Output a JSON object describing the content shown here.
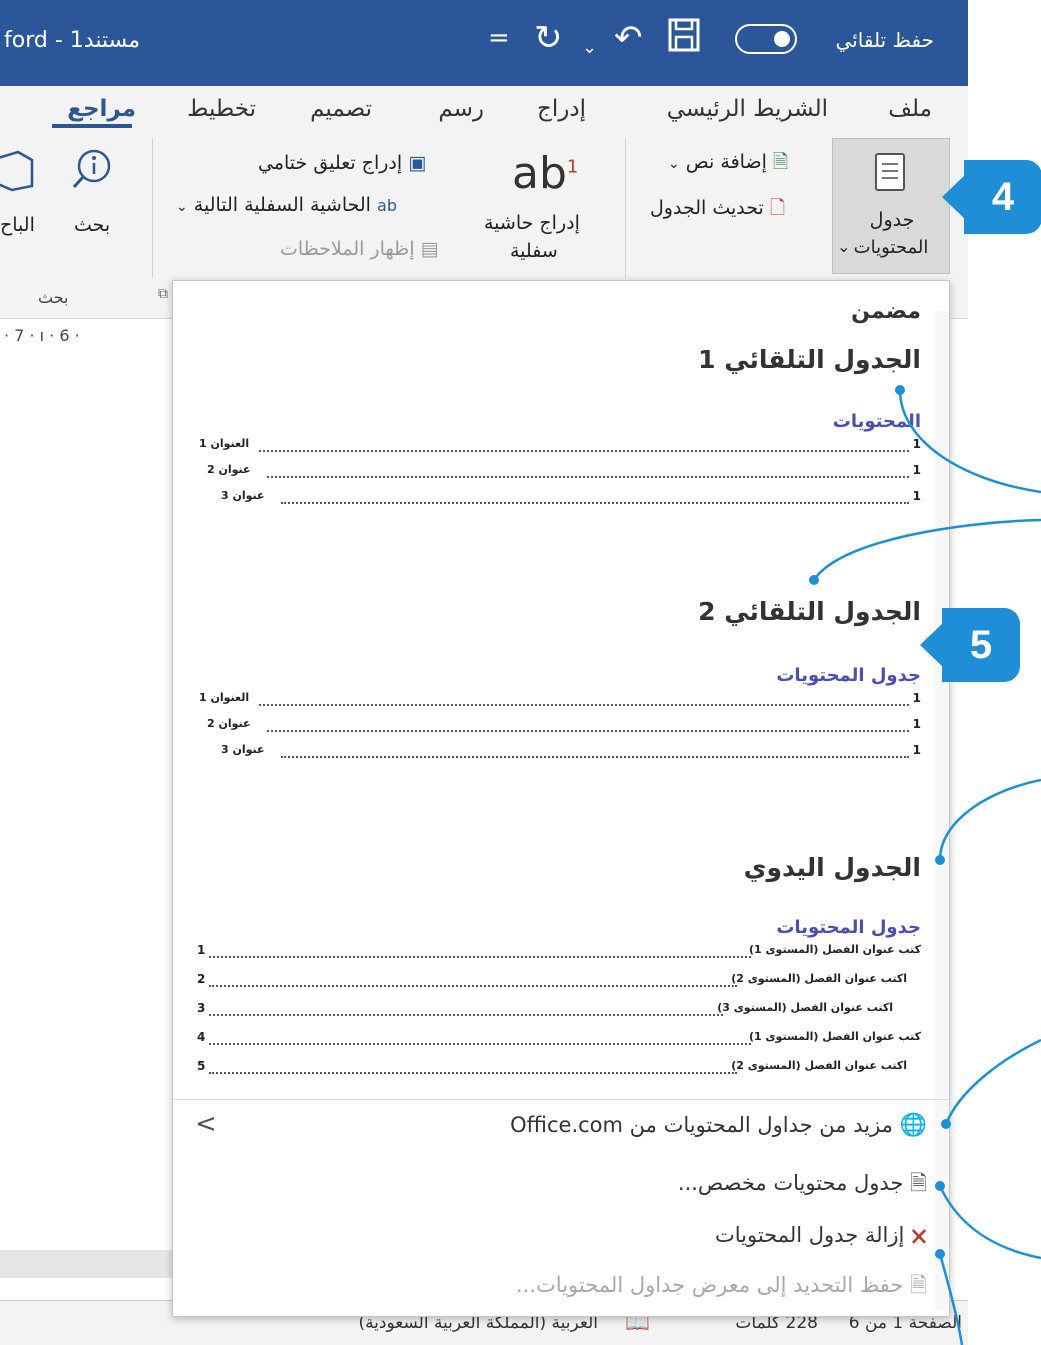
{
  "titlebar": {
    "doc_title": "ford - مستند1",
    "autosave_label": "حفظ تلقائي",
    "icons": [
      "save-icon",
      "redo-icon",
      "undo-icon",
      "customize-qat-icon"
    ]
  },
  "tabs": [
    "ملف",
    "الشريط الرئيسي",
    "إدراج",
    "رسم",
    "تصميم",
    "تخطيط",
    "مراجع"
  ],
  "active_tab": "مراجع",
  "ribbon": {
    "toc_button": "جدول",
    "toc_button_line2": "المحتويات",
    "add_text": "إضافة نص",
    "update_table": "تحديث الجدول",
    "insert_footnote_line1": "إدراج حاشية",
    "insert_footnote_line2": "سفلية",
    "ab_glyph": "ab",
    "footnote_mark": "1",
    "insert_endnote": "إدراج تعليق ختامي",
    "next_footnote": "الحاشية السفلية التالية",
    "show_notes": "إظهار الملاحظات",
    "search": "بحث",
    "researcher": "الباح",
    "search_group": "بحث"
  },
  "ruler": "· 7 · ı · 6 ·",
  "gallery": {
    "section_title": "مضمن",
    "auto1": {
      "title": "الجدول التلقائي 1",
      "toc_label": "المحتويات",
      "entries": [
        {
          "text": "العنوان 1",
          "num": "1"
        },
        {
          "text": "عنوان 2",
          "num": "1"
        },
        {
          "text": "عنوان 3",
          "num": "1"
        }
      ]
    },
    "auto2": {
      "title": "الجدول التلقائي 2",
      "toc_label": "جدول المحتويات",
      "entries": [
        {
          "text": "العنوان 1",
          "num": "1"
        },
        {
          "text": "عنوان 2",
          "num": "1"
        },
        {
          "text": "عنوان 3",
          "num": "1"
        }
      ]
    },
    "manual": {
      "title": "الجدول اليدوي",
      "toc_label": "جدول المحتويات",
      "entries": [
        {
          "text": "كتب عنوان الفصل (المستوى 1)",
          "num": "1"
        },
        {
          "text": "اكتب عنوان الفصل (المستوى 2)",
          "num": "2"
        },
        {
          "text": "اكتب عنوان الفصل (المستوى 3)",
          "num": "3"
        },
        {
          "text": "كتب عنوان الفصل (المستوى 1)",
          "num": "4"
        },
        {
          "text": "اكتب عنوان الفصل (المستوى 2)",
          "num": "5"
        }
      ]
    },
    "commands": {
      "more_from_office": "مزيد من جداول المحتويات من Office.com",
      "custom_toc": "جدول محتويات مخصص...",
      "remove_toc": "إزالة جدول المحتويات",
      "save_selection": "حفظ التحديد إلى معرض جداول المحتويات..."
    }
  },
  "status": {
    "page": "الصفحة 1 من 6",
    "words": "228 كلمات",
    "language": "العربية (المملكة العربية السعودية)"
  },
  "callouts": {
    "a": "4",
    "b": "5"
  },
  "accent_color": "#2b579a",
  "callout_color": "#1e8fd6"
}
